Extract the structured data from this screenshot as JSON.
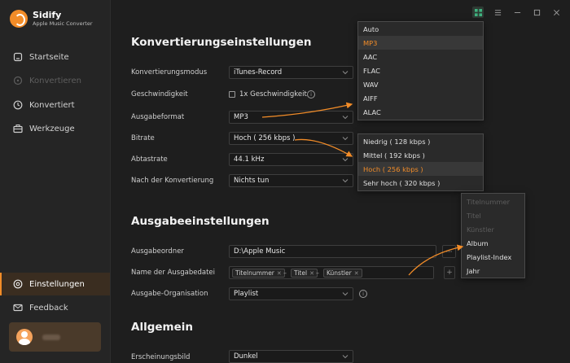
{
  "app": {
    "title": "Sidify",
    "subtitle": "Apple Music Converter"
  },
  "colors": {
    "accent": "#f28c28",
    "background": "#1e1e1e",
    "sidebar": "#252525"
  },
  "sidebar": {
    "items": [
      {
        "label": "Startseite",
        "icon": "home-icon"
      },
      {
        "label": "Konvertieren",
        "icon": "convert-icon"
      },
      {
        "label": "Konvertiert",
        "icon": "clock-icon"
      },
      {
        "label": "Werkzeuge",
        "icon": "toolbox-icon"
      },
      {
        "label": "Einstellungen",
        "icon": "gear-icon"
      },
      {
        "label": "Feedback",
        "icon": "mail-icon"
      }
    ]
  },
  "sections": {
    "conversion": "Konvertierungseinstellungen",
    "output": "Ausgabeeinstellungen",
    "general": "Allgemein"
  },
  "conversion": {
    "mode_label": "Konvertierungsmodus",
    "mode_value": "iTunes-Record",
    "speed_label": "Geschwindigkeit",
    "speed_checkbox": "1x Geschwindigkeit",
    "format_label": "Ausgabeformat",
    "format_value": "MP3",
    "bitrate_label": "Bitrate",
    "bitrate_value": "Hoch ( 256 kbps )",
    "samplerate_label": "Abtastrate",
    "samplerate_value": "44.1 kHz",
    "after_label": "Nach der Konvertierung",
    "after_value": "Nichts tun"
  },
  "output": {
    "folder_label": "Ausgabeordner",
    "folder_value": "D:\\Apple Music",
    "more_label": "···",
    "filename_label": "Name der Ausgabedatei",
    "filename_tags": [
      "Titelnummer",
      "Titel",
      "Künstler"
    ],
    "tag_separator": "–",
    "organize_label": "Ausgabe-Organisation",
    "organize_value": "Playlist",
    "plus_label": "+"
  },
  "general": {
    "appearance_label": "Erscheinungsbild",
    "appearance_value": "Dunkel"
  },
  "format_dropdown": {
    "options": [
      "Auto",
      "MP3",
      "AAC",
      "FLAC",
      "WAV",
      "AIFF",
      "ALAC"
    ],
    "selected": "MP3"
  },
  "bitrate_dropdown": {
    "options": [
      "Niedrig ( 128 kbps )",
      "Mittel ( 192 kbps )",
      "Hoch ( 256 kbps )",
      "Sehr hoch ( 320 kbps )"
    ],
    "selected": "Hoch ( 256 kbps )"
  },
  "tag_dropdown": {
    "options": [
      "Titelnummer",
      "Titel",
      "Künstler",
      "Album",
      "Playlist-Index",
      "Jahr"
    ],
    "disabled": [
      "Titelnummer",
      "Titel",
      "Künstler"
    ]
  }
}
